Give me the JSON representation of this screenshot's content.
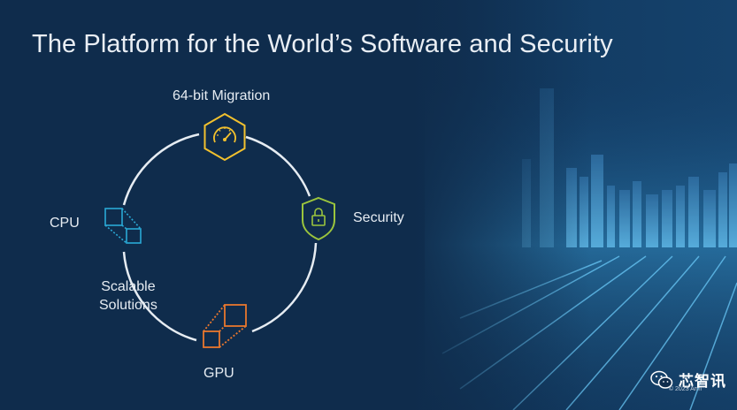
{
  "slide": {
    "title": "The Platform for the World’s Software and Security",
    "labels": {
      "migration": "64-bit Migration",
      "security": "Security",
      "cpu": "CPU",
      "scalable_line1": "Scalable",
      "scalable_line2": "Solutions",
      "gpu": "GPU"
    },
    "icons": {
      "migration": "speedometer-hexagon-icon",
      "security": "shield-lock-icon",
      "cpu": "cpu-squares-icon",
      "gpu": "gpu-squares-icon"
    },
    "colors": {
      "migration": "#f2c12e",
      "security": "#9bc53d",
      "cpu": "#2aa9d6",
      "gpu": "#e8772e"
    }
  },
  "watermark": {
    "text": "芯智讯",
    "icon": "wechat-icon",
    "copyright": "© 2023 Arm"
  }
}
